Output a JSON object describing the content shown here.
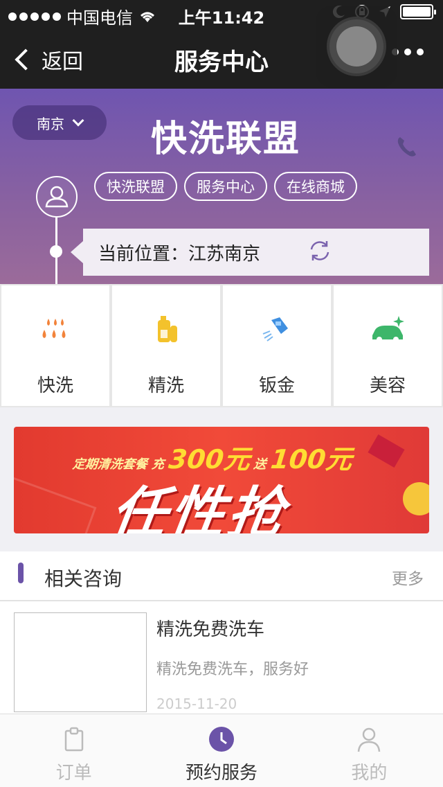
{
  "status_bar": {
    "carrier": "中国电信",
    "time": "上午11:42"
  },
  "nav": {
    "back_label": "返回",
    "title": "服务中心"
  },
  "header": {
    "city": "南京",
    "brand_title": "快洗联盟",
    "tags": [
      "快洗联盟",
      "服务中心",
      "在线商城"
    ],
    "location_text": "当前位置：江苏南京"
  },
  "services": [
    {
      "label": "快洗",
      "icon": "water-drops-icon",
      "color": "#f2833a"
    },
    {
      "label": "精洗",
      "icon": "shampoo-bottle-icon",
      "color": "#f3c22c"
    },
    {
      "label": "钣金",
      "icon": "spray-gun-icon",
      "color": "#3f8fe0"
    },
    {
      "label": "美容",
      "icon": "sparkle-car-icon",
      "color": "#3db66a"
    }
  ],
  "banner": {
    "line1_prefix": "定期清洗套餐 充",
    "line1_amount": "300元",
    "line1_mid": "送",
    "line1_bonus": "100元",
    "line2": "任性抢"
  },
  "consult": {
    "title": "相关咨询",
    "more_label": "更多"
  },
  "news": [
    {
      "title": "精洗免费洗车",
      "desc": "精洗免费洗车，服务好",
      "date": "2015-11-20"
    }
  ],
  "tabs": [
    {
      "label": "订单",
      "icon": "clipboard-icon",
      "active": false
    },
    {
      "label": "预约服务",
      "icon": "clock-icon",
      "active": true
    },
    {
      "label": "我的",
      "icon": "person-icon",
      "active": false
    }
  ],
  "colors": {
    "accent": "#6b53a8",
    "nav_bg": "#1f1f1f"
  }
}
